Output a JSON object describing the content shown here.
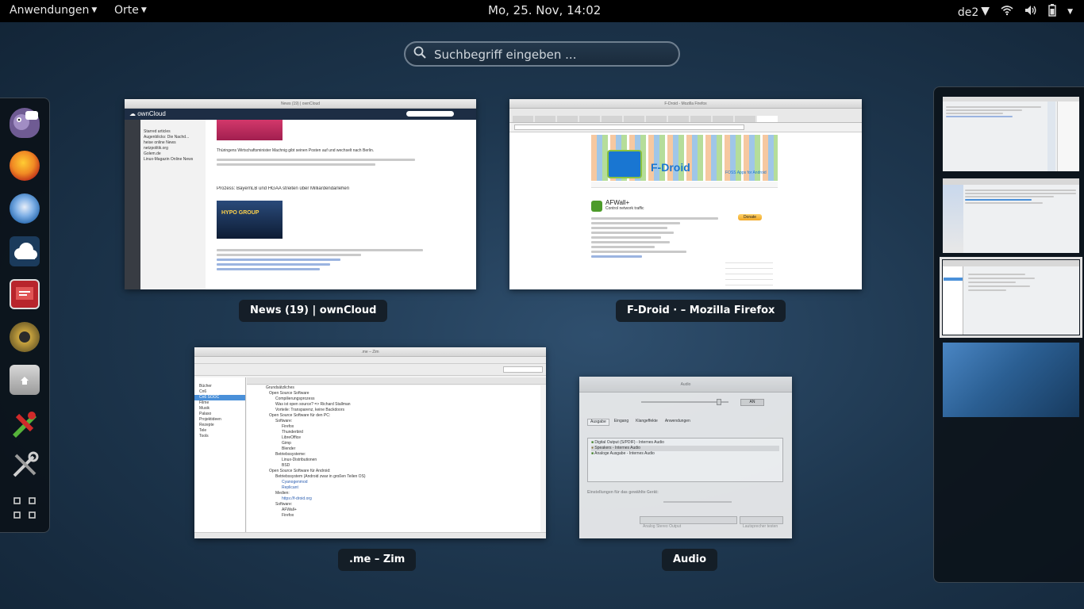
{
  "topbar": {
    "activities": "Anwendungen",
    "places": "Orte",
    "clock": "Mo, 25. Nov, 14:02",
    "keyboard": "de2"
  },
  "search": {
    "placeholder": "Suchbegriff eingeben ..."
  },
  "dash": {
    "apps": [
      {
        "name": "pidgin-icon",
        "color": "#6f5b93"
      },
      {
        "name": "firefox-icon",
        "color": "#e3682a"
      },
      {
        "name": "thunderbird-icon",
        "color": "#2f6fb4"
      },
      {
        "name": "owncloud-icon",
        "color": "#1b3b5c"
      },
      {
        "name": "presentation-icon",
        "color": "#b8252c"
      },
      {
        "name": "speaker-icon",
        "color": "#8c7430"
      },
      {
        "name": "files-icon",
        "color": "#8f8f8f"
      },
      {
        "name": "editor-icon",
        "color": "#3f8a2b"
      },
      {
        "name": "settings-tools-icon",
        "color": "#7d7d7d"
      },
      {
        "name": "show-apps-icon",
        "color": "#cccccc"
      }
    ]
  },
  "windows": {
    "owncloud": {
      "label": "News (19) | ownCloud",
      "sidebar_items": [
        "Starred articles",
        "Augenblicks: Die Nachd...",
        "heise online News",
        "netzpolitik.org",
        "Golem.de",
        "Linux-Magazin Online News"
      ],
      "headline": "Prozess: BayernLB und HGAA streiten über Milliardendarlehen",
      "body": "Thüringens Wirtschaftsminister Machnig gibt seinen Posten auf und wechselt nach Berlin."
    },
    "fdroid": {
      "label": "F-Droid · – Mozilla Firefox",
      "title": "F-Droid - Mozilla Firefox",
      "brand": "F-Droid",
      "tagline": "FOSS Apps for Android",
      "app_title": "AFWall+",
      "app_sub": "Control network traffic",
      "donate": "Donate"
    },
    "zim": {
      "label": ".me – Zim",
      "title": ".me – Zim",
      "index": [
        "Bücher",
        "Cn6",
        "Cn6 SOOC",
        "Filme",
        "Musik",
        "Palaso",
        "Projektideen",
        "Rezepte",
        "Tele",
        "Tools"
      ],
      "tree": [
        "Grundsätzliches",
        "Open Source Software",
        "Compilierungsprozess",
        "Was ist open source? => Richard Stallman",
        "Vorteile: Transparenz, keine Backdoors",
        "Open Source Software für den PC:",
        "Software:",
        "Firefox",
        "Thunderbird",
        "LibreOffice",
        "Gimp",
        "Blender",
        "Betriebssysteme:",
        "Linux-Distributionen",
        "BSD",
        "Open Source Software für Android:",
        "Betriebssystem (Android zwar in großen Teilen OS)",
        "Cyanogenmod",
        "Replicant",
        "Medien:",
        "https://f-droid.org",
        "Software:",
        "AFWall+",
        "Firefox"
      ]
    },
    "audio": {
      "label": "Audio",
      "title": "Audio",
      "tabs": [
        "Ausgabe",
        "Eingang",
        "Klangeffekte",
        "Anwendungen"
      ],
      "devices": [
        "Digital Output (S/PDIF) - Internes Audio",
        "Speakers - Internes Audio",
        "Analoge Ausgabe - Internes Audio"
      ],
      "section": "Einstellungen für das gewählte Gerät:",
      "profile": "Analog Stereo Output",
      "test": "Lautsprecher testen"
    }
  },
  "colors": {
    "accent": "#4a90d9",
    "panel": "#000000"
  }
}
